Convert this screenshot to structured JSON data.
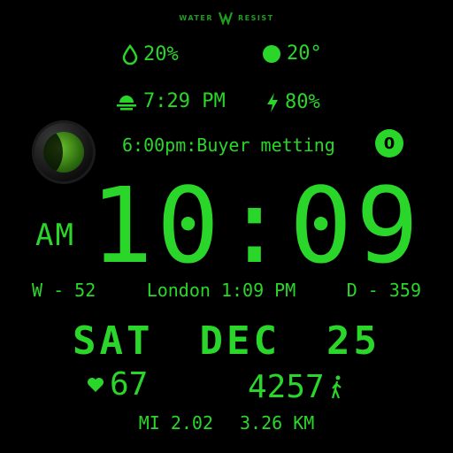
{
  "brand": {
    "left": "WATER",
    "right": "RESIST"
  },
  "weather": {
    "humidity": "20%",
    "temperature": "20°"
  },
  "sun": {
    "sunset": "7:29 PM",
    "battery": "80%"
  },
  "event": {
    "text": "6:00pm:Buyer metting",
    "badge": "0"
  },
  "clock": {
    "ampm": "AM",
    "time": "10:09"
  },
  "info": {
    "week": "W - 52",
    "world_time": "London 1:09 PM",
    "day_of_year": "D - 359"
  },
  "date": {
    "weekday": "SAT",
    "month": "DEC",
    "day": "25"
  },
  "health": {
    "heart_rate": "67",
    "steps": "4257",
    "miles": "MI 2.02",
    "km": "3.26 KM"
  },
  "colors": {
    "accent": "#2bd62b",
    "background": "#000000"
  }
}
